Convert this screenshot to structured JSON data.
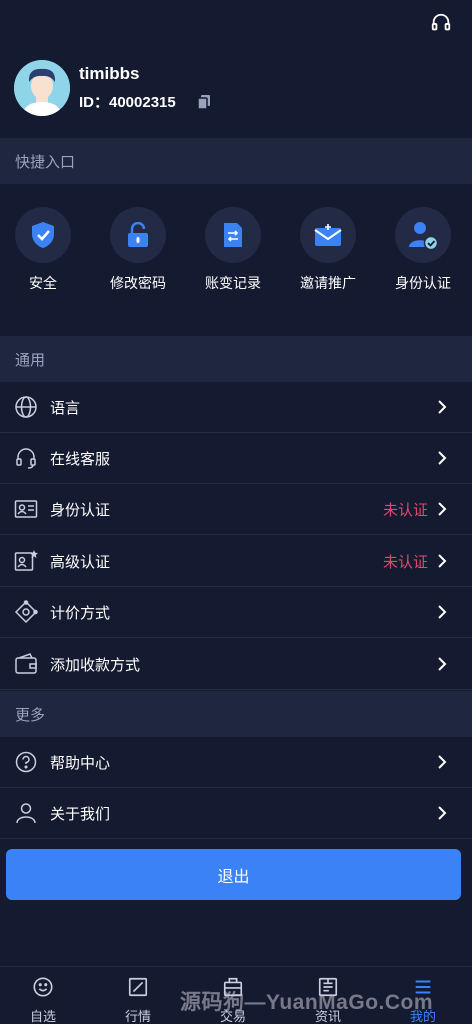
{
  "header": {
    "support_icon": "headset-icon"
  },
  "profile": {
    "username": "timibbs",
    "id_text": "ID：40002315",
    "copy_icon": "copy-icon"
  },
  "quick": {
    "title": "快捷入口",
    "items": [
      {
        "label": "安全",
        "icon": "shield-check-icon"
      },
      {
        "label": "修改密码",
        "icon": "lock-icon"
      },
      {
        "label": "账变记录",
        "icon": "document-icon"
      },
      {
        "label": "邀请推广",
        "icon": "invite-mail-icon"
      },
      {
        "label": "身份认证",
        "icon": "user-verified-icon"
      }
    ]
  },
  "general": {
    "title": "通用",
    "items": [
      {
        "label": "语言",
        "icon": "globe-icon",
        "status": ""
      },
      {
        "label": "在线客服",
        "icon": "headset-icon",
        "status": ""
      },
      {
        "label": "身份认证",
        "icon": "id-card-icon",
        "status": "未认证"
      },
      {
        "label": "高级认证",
        "icon": "id-card-star-icon",
        "status": "未认证"
      },
      {
        "label": "计价方式",
        "icon": "pricing-icon",
        "status": ""
      },
      {
        "label": "添加收款方式",
        "icon": "wallet-icon",
        "status": ""
      }
    ]
  },
  "more": {
    "title": "更多",
    "items": [
      {
        "label": "帮助中心",
        "icon": "help-icon"
      },
      {
        "label": "关于我们",
        "icon": "user-icon"
      }
    ]
  },
  "logout_label": "退出",
  "tabs": [
    {
      "label": "自选",
      "icon": "smiley-icon",
      "active": false
    },
    {
      "label": "行情",
      "icon": "chart-icon",
      "active": false
    },
    {
      "label": "交易",
      "icon": "trade-icon",
      "active": false
    },
    {
      "label": "资讯",
      "icon": "news-icon",
      "active": false
    },
    {
      "label": "我的",
      "icon": "menu-icon",
      "active": true
    }
  ],
  "colors": {
    "background": "#141a30",
    "section": "#1f2640",
    "accent": "#3b82f6",
    "warning": "#e04a6a"
  },
  "watermark": "源码狗—YuanMaGo.Com"
}
